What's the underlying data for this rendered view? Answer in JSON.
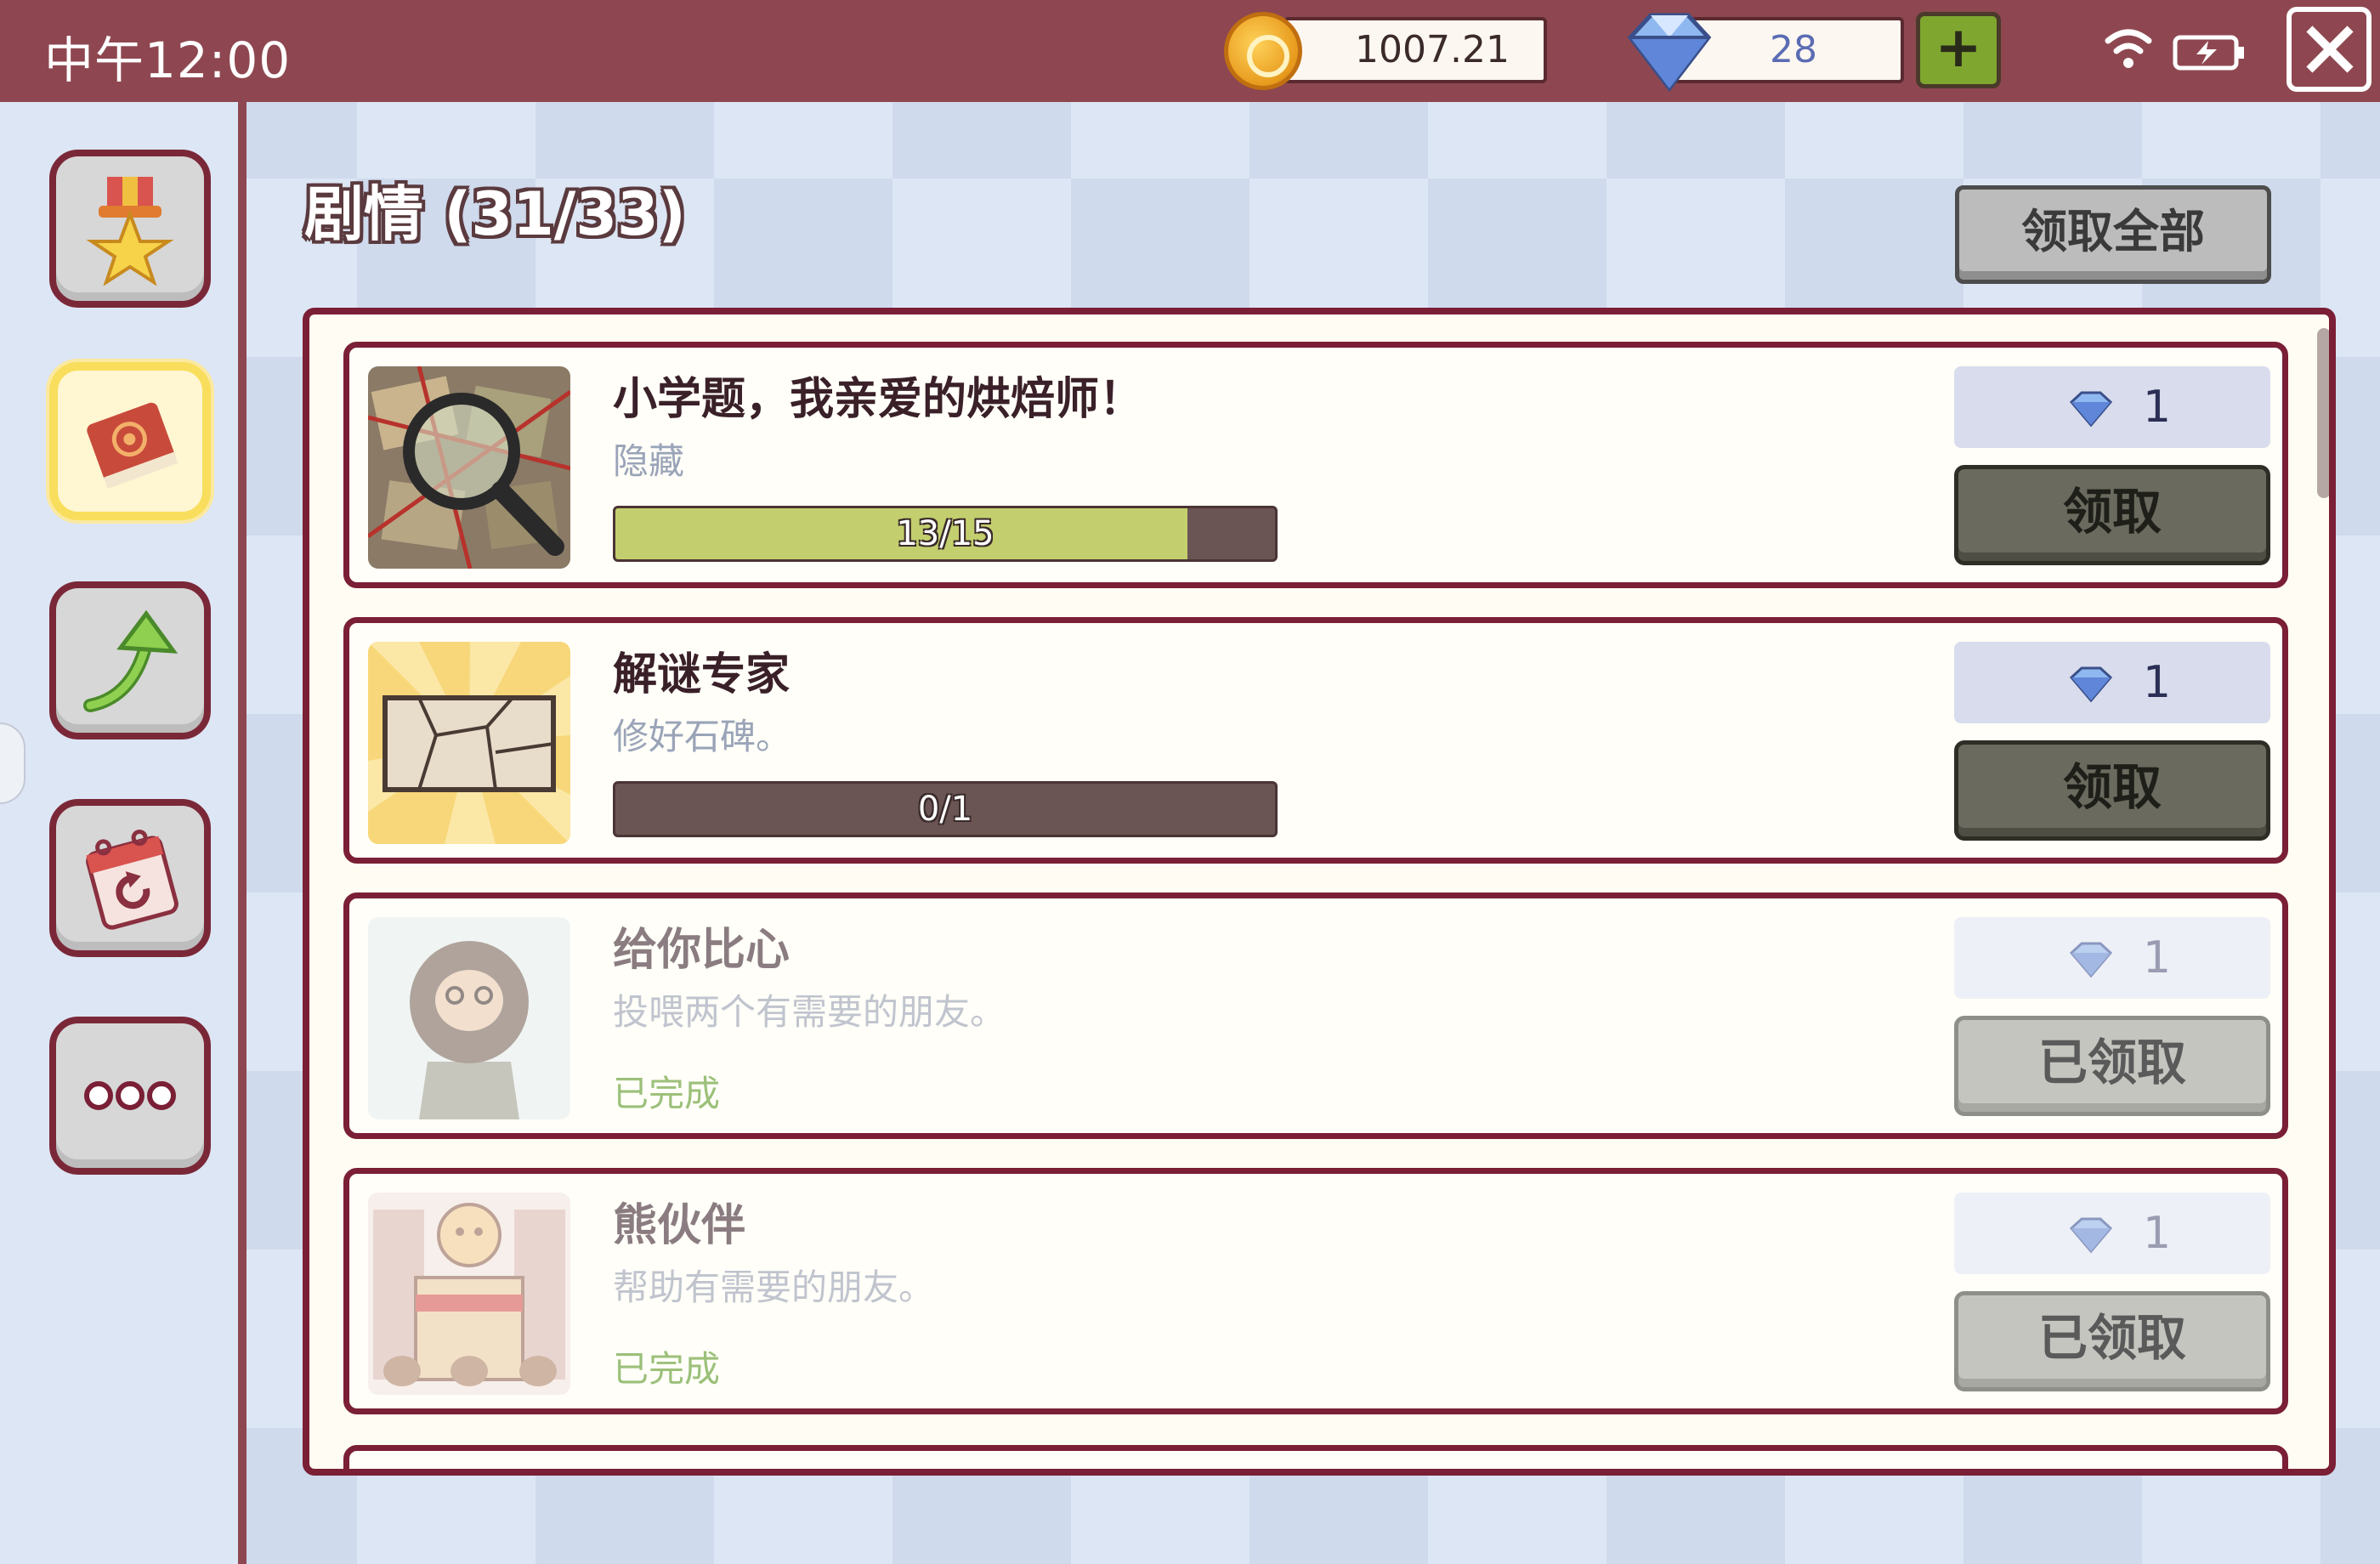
{
  "status_bar": {
    "time": "中午12:00",
    "coins": "1007.21",
    "gems": "28",
    "plus_label": "+"
  },
  "header": {
    "title": "剧情 (31/33)",
    "claim_all_label": "领取全部"
  },
  "sidebar": {
    "items": [
      {
        "name": "achievements",
        "icon": "medal-star-icon",
        "active": false
      },
      {
        "name": "story",
        "icon": "book-icon",
        "active": true
      },
      {
        "name": "upgrade",
        "icon": "arrow-up-icon",
        "active": false
      },
      {
        "name": "daily",
        "icon": "calendar-refresh-icon",
        "active": false
      },
      {
        "name": "more",
        "icon": "more-dots-icon",
        "active": false
      }
    ]
  },
  "quests": [
    {
      "title": "小学题，我亲爱的烘焙师！",
      "description": "隐藏",
      "progress_text": "13/15",
      "progress": 0.867,
      "reward_count": "1",
      "button_label": "领取",
      "state": "in_progress",
      "thumb_icon": "magnifier-map-icon"
    },
    {
      "title": "解谜专家",
      "description": "修好石碑。",
      "progress_text": "0/1",
      "progress": 0,
      "reward_count": "1",
      "button_label": "领取",
      "state": "in_progress",
      "thumb_icon": "cracked-tablet-icon"
    },
    {
      "title": "给你比心",
      "description": "投喂两个有需要的朋友。",
      "status_text": "已完成",
      "reward_count": "1",
      "button_label": "已领取",
      "state": "claimed",
      "thumb_icon": "bearded-man-icon"
    },
    {
      "title": "熊伙伴",
      "description": "帮助有需要的朋友。",
      "status_text": "已完成",
      "reward_count": "1",
      "button_label": "已领取",
      "state": "claimed",
      "thumb_icon": "bakery-shop-icon"
    }
  ],
  "colors": {
    "topbar": "#8e4750",
    "panel_border": "#7a1f36",
    "progress_fill": "#c3cf6e",
    "gem_blue": "#5b6cb4"
  }
}
